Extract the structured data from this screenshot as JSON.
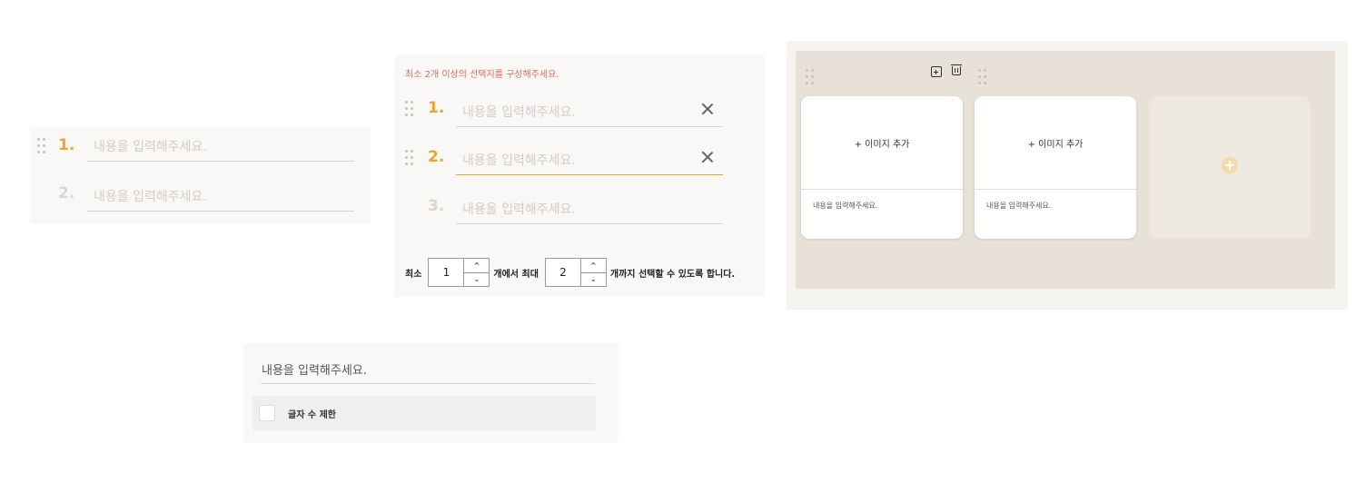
{
  "short_answer_list": {
    "items": [
      {
        "number": "1.",
        "placeholder": "내용을 입력해주세요."
      },
      {
        "number": "2.",
        "placeholder": "내용을 입력해주세요."
      }
    ]
  },
  "multi_choice": {
    "warning": "최소 2개 이상의 선택지를 구성해주세요.",
    "items": [
      {
        "number": "1.",
        "placeholder": "내용을 입력해주세요."
      },
      {
        "number": "2.",
        "placeholder": "내용을 입력해주세요."
      },
      {
        "number": "3.",
        "placeholder": "내용을 입력해주세요."
      }
    ],
    "min_label": "최소",
    "min_value": "1",
    "mid_label": "개에서 최대",
    "max_value": "2",
    "suffix_label": "개까지 선택할 수 있도록 합니다.",
    "up_arrow": "^",
    "down_arrow": "⌄"
  },
  "image_choice": {
    "cards": [
      {
        "add_label": "+ 이미지 추가",
        "caption": "내용을 입력해주세요."
      },
      {
        "add_label": "+ 이미지 추가",
        "caption": "내용을 입력해주세요."
      }
    ]
  },
  "text_answer": {
    "placeholder": "내용을 입력해주세요.",
    "limit_label": "글자 수 제한"
  },
  "colors": {
    "accent": "#e8a530",
    "warning": "#e06a56",
    "image_panel_bg": "#e7e1d7"
  }
}
